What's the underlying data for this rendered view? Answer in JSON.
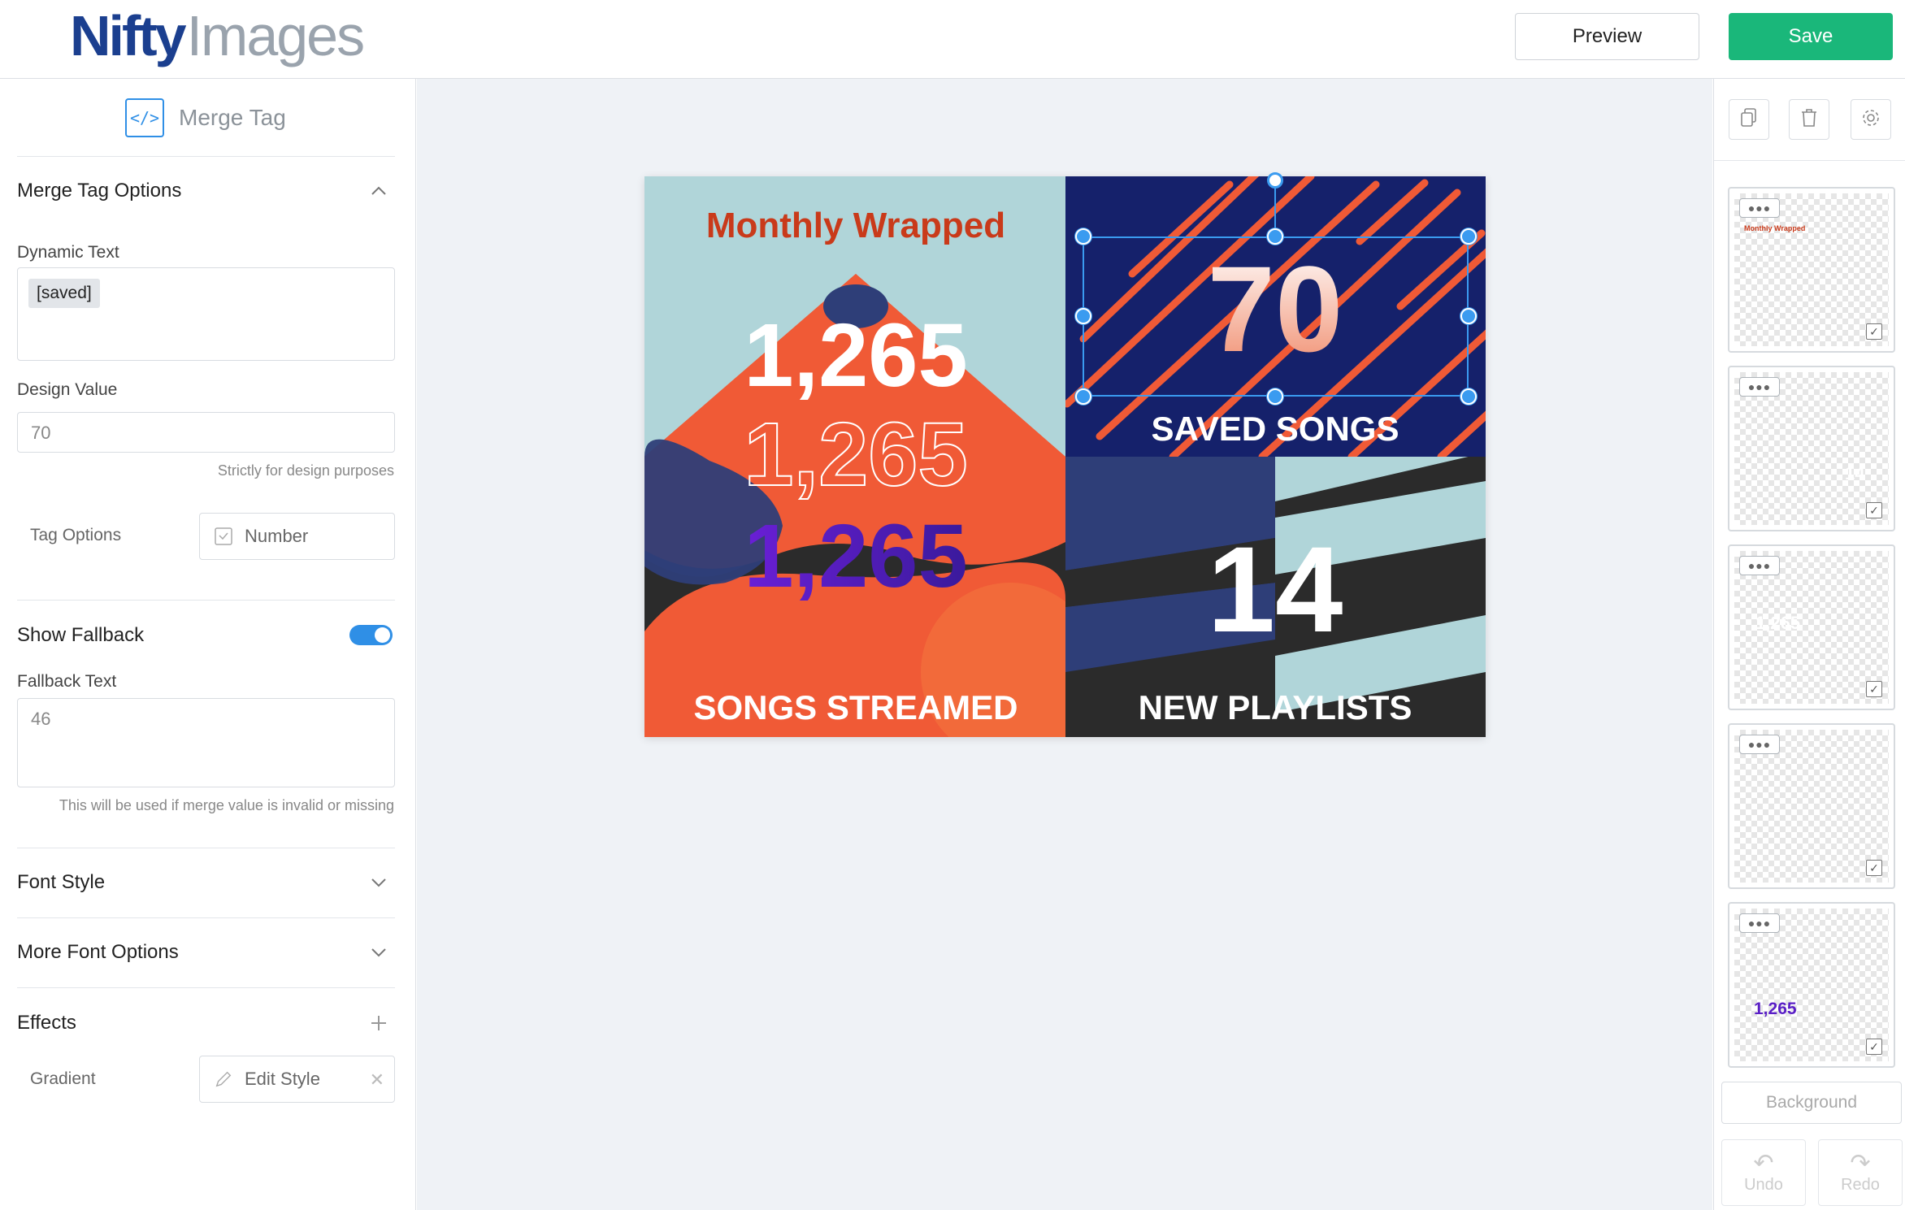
{
  "header": {
    "logo_strong": "Nifty",
    "logo_light": "Images",
    "preview_label": "Preview",
    "save_label": "Save"
  },
  "left_panel": {
    "title": "Merge Tag",
    "merge_tag_options": {
      "title": "Merge Tag Options",
      "dynamic_text_label": "Dynamic Text",
      "dynamic_text_chip": "[saved]",
      "design_value_label": "Design Value",
      "design_value": "70",
      "design_value_hint": "Strictly for design purposes",
      "tag_options_label": "Tag Options",
      "tag_options_value": "Number"
    },
    "fallback": {
      "show_label": "Show Fallback",
      "enabled": true,
      "text_label": "Fallback Text",
      "text_value": "46",
      "hint": "This will be used if merge value is invalid or missing"
    },
    "font_style_label": "Font Style",
    "more_font_options_label": "More Font Options",
    "effects": {
      "title": "Effects",
      "gradient_label": "Gradient",
      "edit_style_label": "Edit Style"
    }
  },
  "design": {
    "title": "Monthly Wrapped",
    "big_number": "1,265",
    "songs_streamed_label": "SONGS STREAMED",
    "saved_number": "70",
    "saved_songs_label": "SAVED SONGS",
    "playlists_number": "14",
    "new_playlists_label": "NEW PLAYLISTS",
    "colors": {
      "light_blue": "#b0d5d9",
      "orange": "#f05a36",
      "navy": "#15216b",
      "dark": "#2b2b2b",
      "title_red": "#c93a1a"
    }
  },
  "right_panel": {
    "tools": [
      "copy-icon",
      "trash-icon",
      "gear-icon"
    ],
    "layers": [
      {
        "preview_text": "Monthly Wrapped"
      },
      {
        "preview_text": "14"
      },
      {
        "preview_text": "1,265"
      },
      {
        "preview_text": ""
      },
      {
        "preview_text": "1,265"
      }
    ],
    "background_label": "Background",
    "undo_label": "Undo",
    "redo_label": "Redo"
  }
}
